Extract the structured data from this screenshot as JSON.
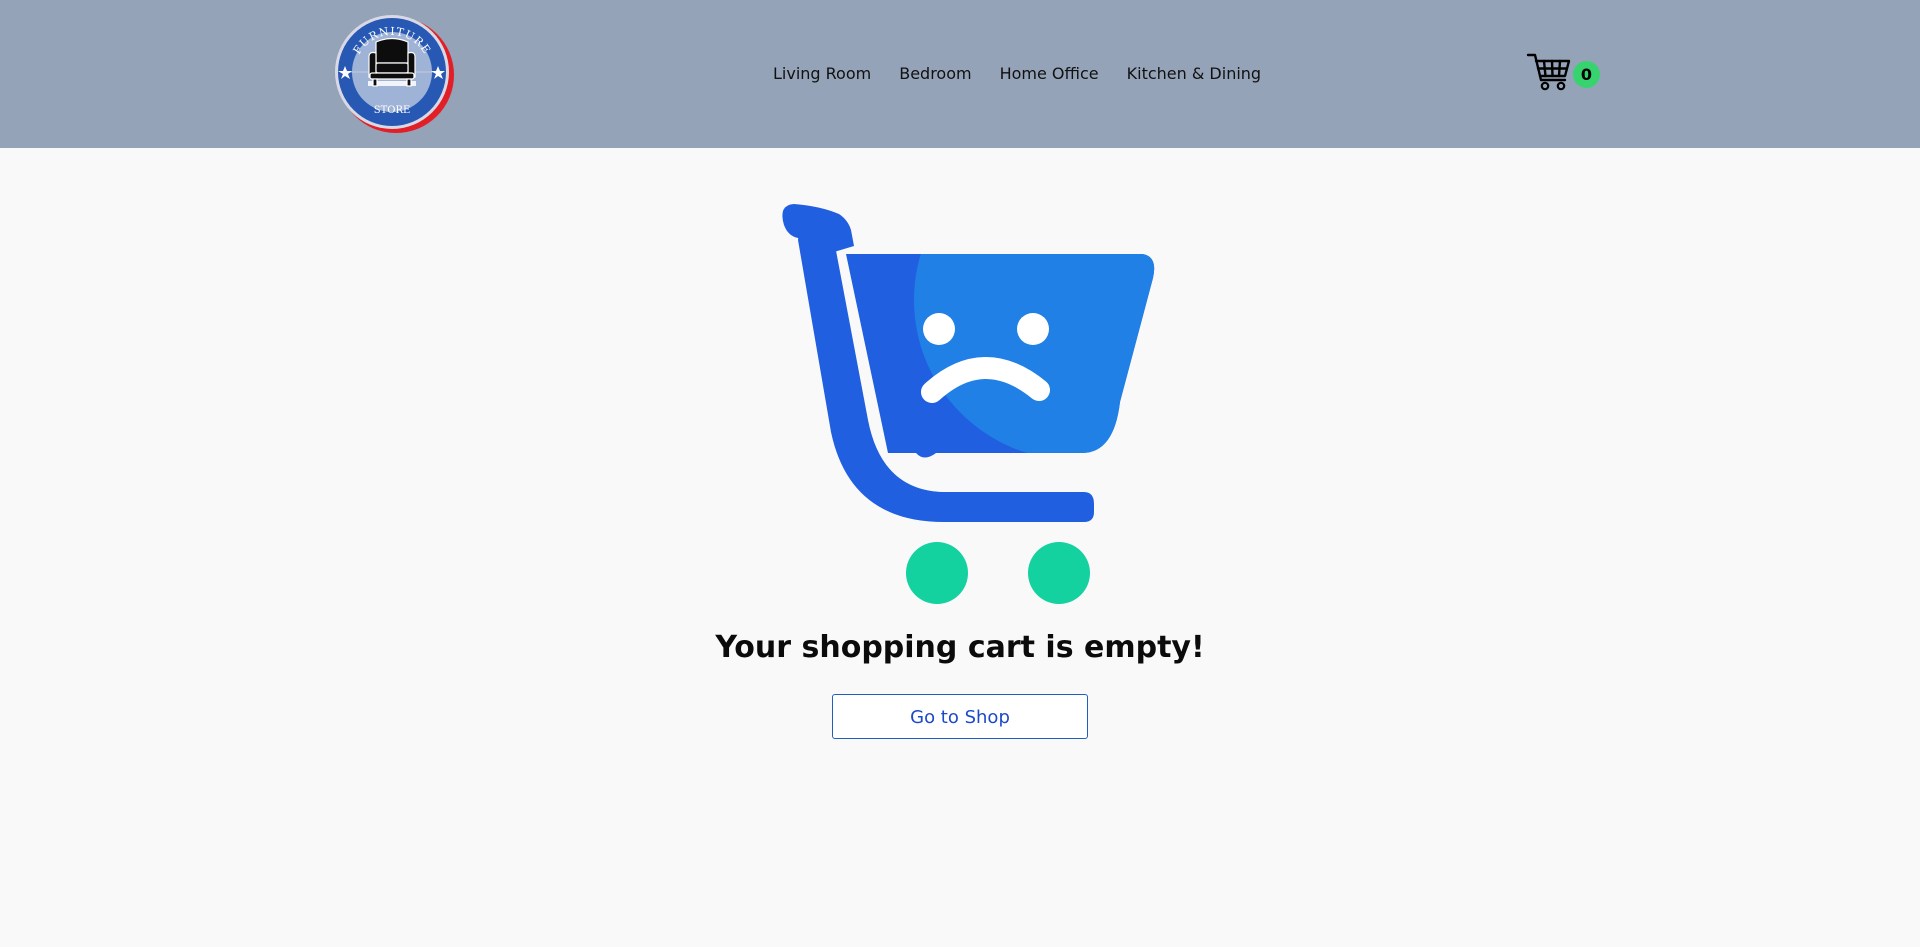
{
  "header": {
    "logo": {
      "text_top": "FURNITURE",
      "text_bottom": "STORE",
      "icon": "armchair-icon"
    },
    "nav": [
      {
        "label": "Living Room"
      },
      {
        "label": "Bedroom"
      },
      {
        "label": "Home Office"
      },
      {
        "label": "Kitchen & Dining"
      }
    ],
    "cart": {
      "icon": "shopping-cart-icon",
      "count": "0"
    }
  },
  "main": {
    "illustration_icon": "sad-shopping-cart-icon",
    "title": "Your shopping cart is empty!",
    "button_label": "Go to Shop"
  },
  "colors": {
    "header_bg": "#95a3b8",
    "page_bg": "#f9f9f9",
    "cart_blue": "#1f5fe0",
    "wheel_green": "#14d1a0",
    "badge_green": "#37d36f",
    "button_text": "#1d49c9"
  }
}
